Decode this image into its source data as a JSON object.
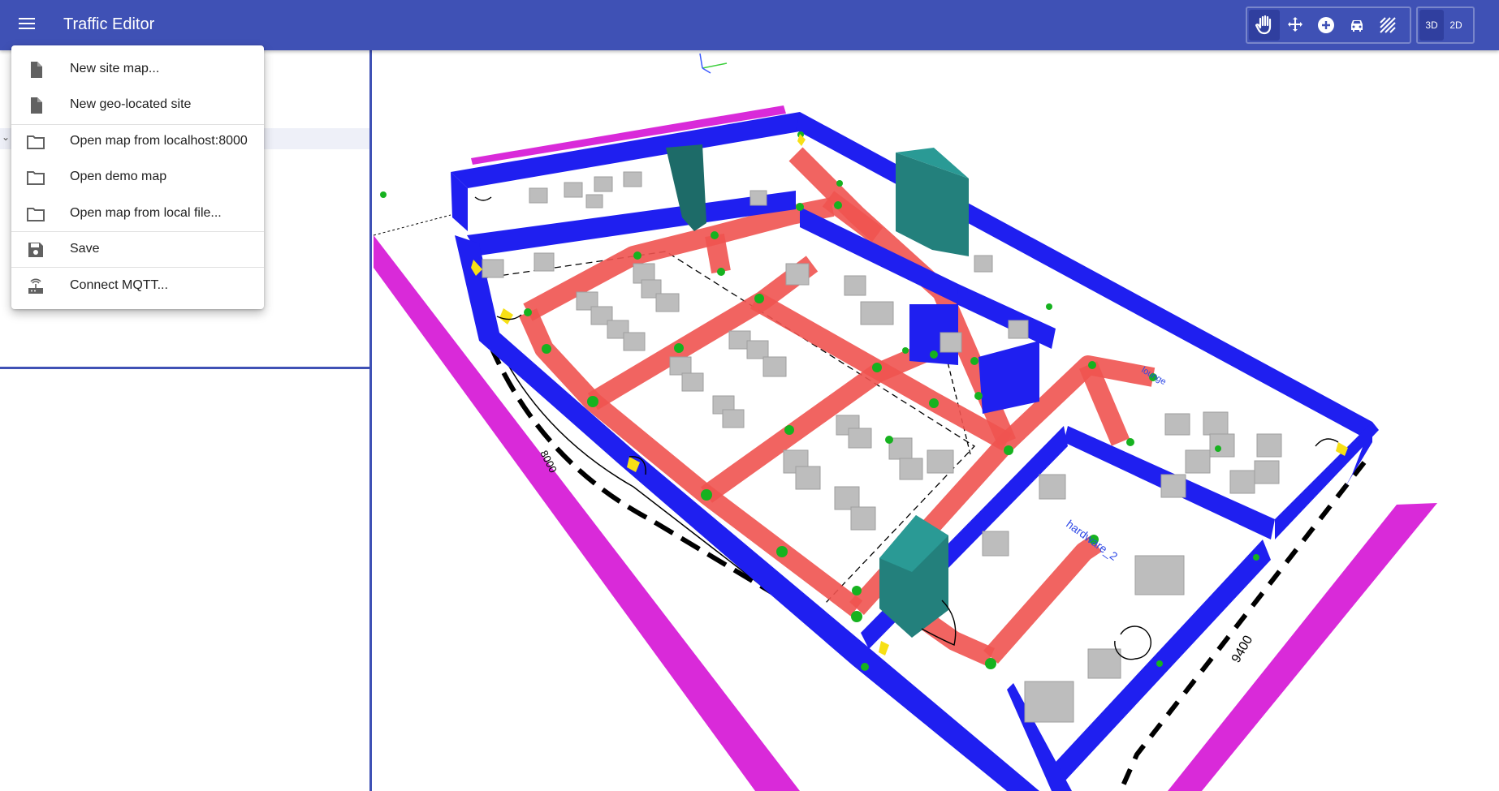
{
  "app": {
    "title": "Traffic Editor"
  },
  "menu": {
    "items": [
      {
        "label": "New site map...",
        "icon": "file-icon"
      },
      {
        "label": "New geo-located site",
        "icon": "file-icon"
      },
      {
        "label": "Open map from localhost:8000",
        "icon": "folder-icon"
      },
      {
        "label": "Open demo map",
        "icon": "folder-icon"
      },
      {
        "label": "Open map from local file...",
        "icon": "folder-icon"
      },
      {
        "label": "Save",
        "icon": "save-icon"
      },
      {
        "label": "Connect MQTT...",
        "icon": "router-icon"
      }
    ]
  },
  "toolbar": {
    "tools": [
      {
        "name": "pan",
        "icon": "hand-icon",
        "active": true
      },
      {
        "name": "move",
        "icon": "move-arrows-icon",
        "active": false
      },
      {
        "name": "add",
        "icon": "add-circle-icon",
        "active": false
      },
      {
        "name": "vehicle",
        "icon": "car-icon",
        "active": false
      },
      {
        "name": "hatch",
        "icon": "hatch-icon",
        "active": false
      }
    ],
    "view_modes": [
      {
        "label": "3D",
        "active": true
      },
      {
        "label": "2D",
        "active": false
      }
    ]
  },
  "scene": {
    "labels": {
      "hardware_2": "hardware_2",
      "lounge": "lounge",
      "dim_left": "8000",
      "dim_right": "9400"
    },
    "colors": {
      "walls": "#1f1ff0",
      "lanes": "#ef5350",
      "nodes": "#16b21f",
      "floor_border": "#d92ad9",
      "pillars": "#23807c",
      "furniture": "#bdbdbd"
    }
  }
}
